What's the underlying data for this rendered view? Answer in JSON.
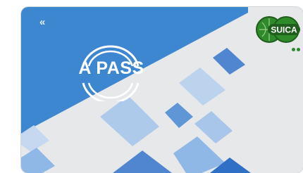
{
  "card": {
    "nav_glyph": "«",
    "logo_text": "A PASS",
    "logo_icon": "sun-ring-icon",
    "badge_text": "SUICA",
    "badge_icon": "suica-badge-icon"
  },
  "colors": {
    "primary_blue": "#3d86d0",
    "light_blue": "#8fb8e6",
    "card_bg": "#e6e8ea",
    "badge_green": "#2f8a2a"
  }
}
